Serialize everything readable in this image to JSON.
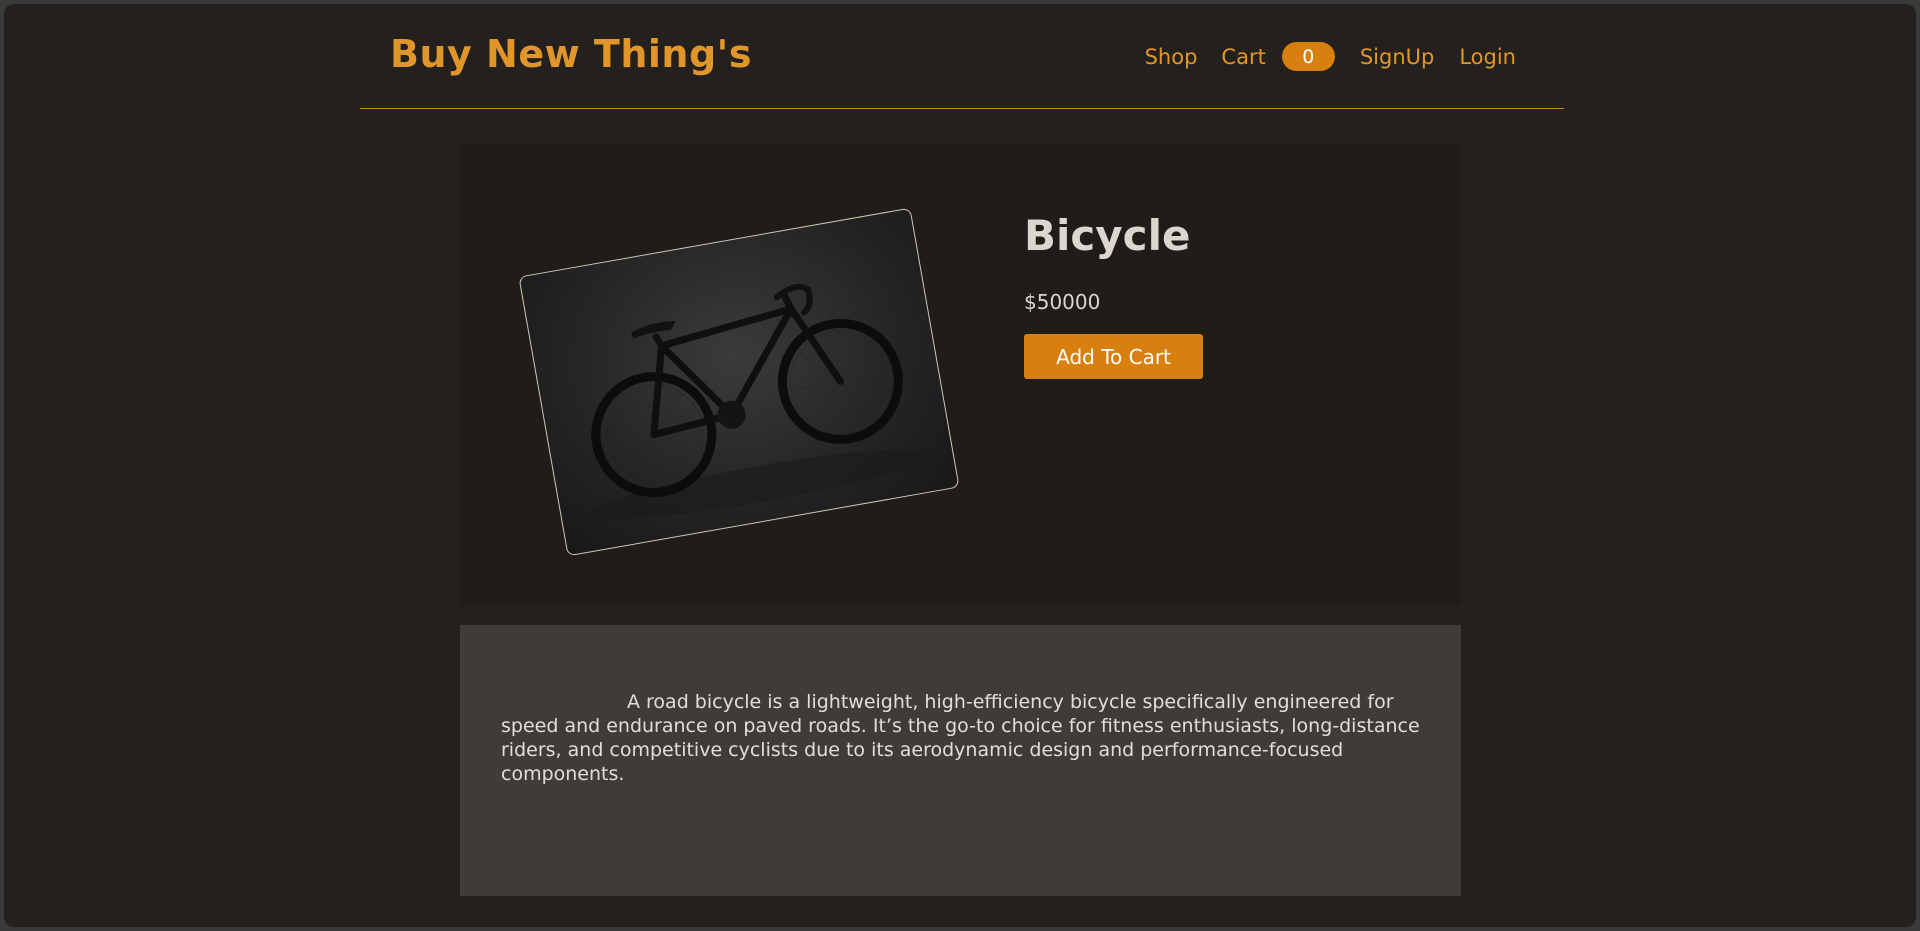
{
  "header": {
    "brand": "Buy New Thing's",
    "nav": {
      "shop": "Shop",
      "cart": "Cart",
      "cart_count": "0",
      "signup": "SignUp",
      "login": "Login"
    }
  },
  "product": {
    "image_icon": "bicycle-photo",
    "name": "Bicycle",
    "price": "$50000",
    "add_to_cart_label": "Add To Cart",
    "description": "A road bicycle is a lightweight, high-efficiency bicycle specifically engineered for speed and endurance on paved roads. It’s the go-to choice for fitness enthusiasts, long-distance riders, and competitive cyclists due to its aerodynamic design and performance-focused components."
  },
  "colors": {
    "accent": "#e0962a",
    "button": "#d7800f",
    "page_bg": "#24201d",
    "card_bg": "#1f1c19",
    "desc_bg": "#403b38"
  }
}
